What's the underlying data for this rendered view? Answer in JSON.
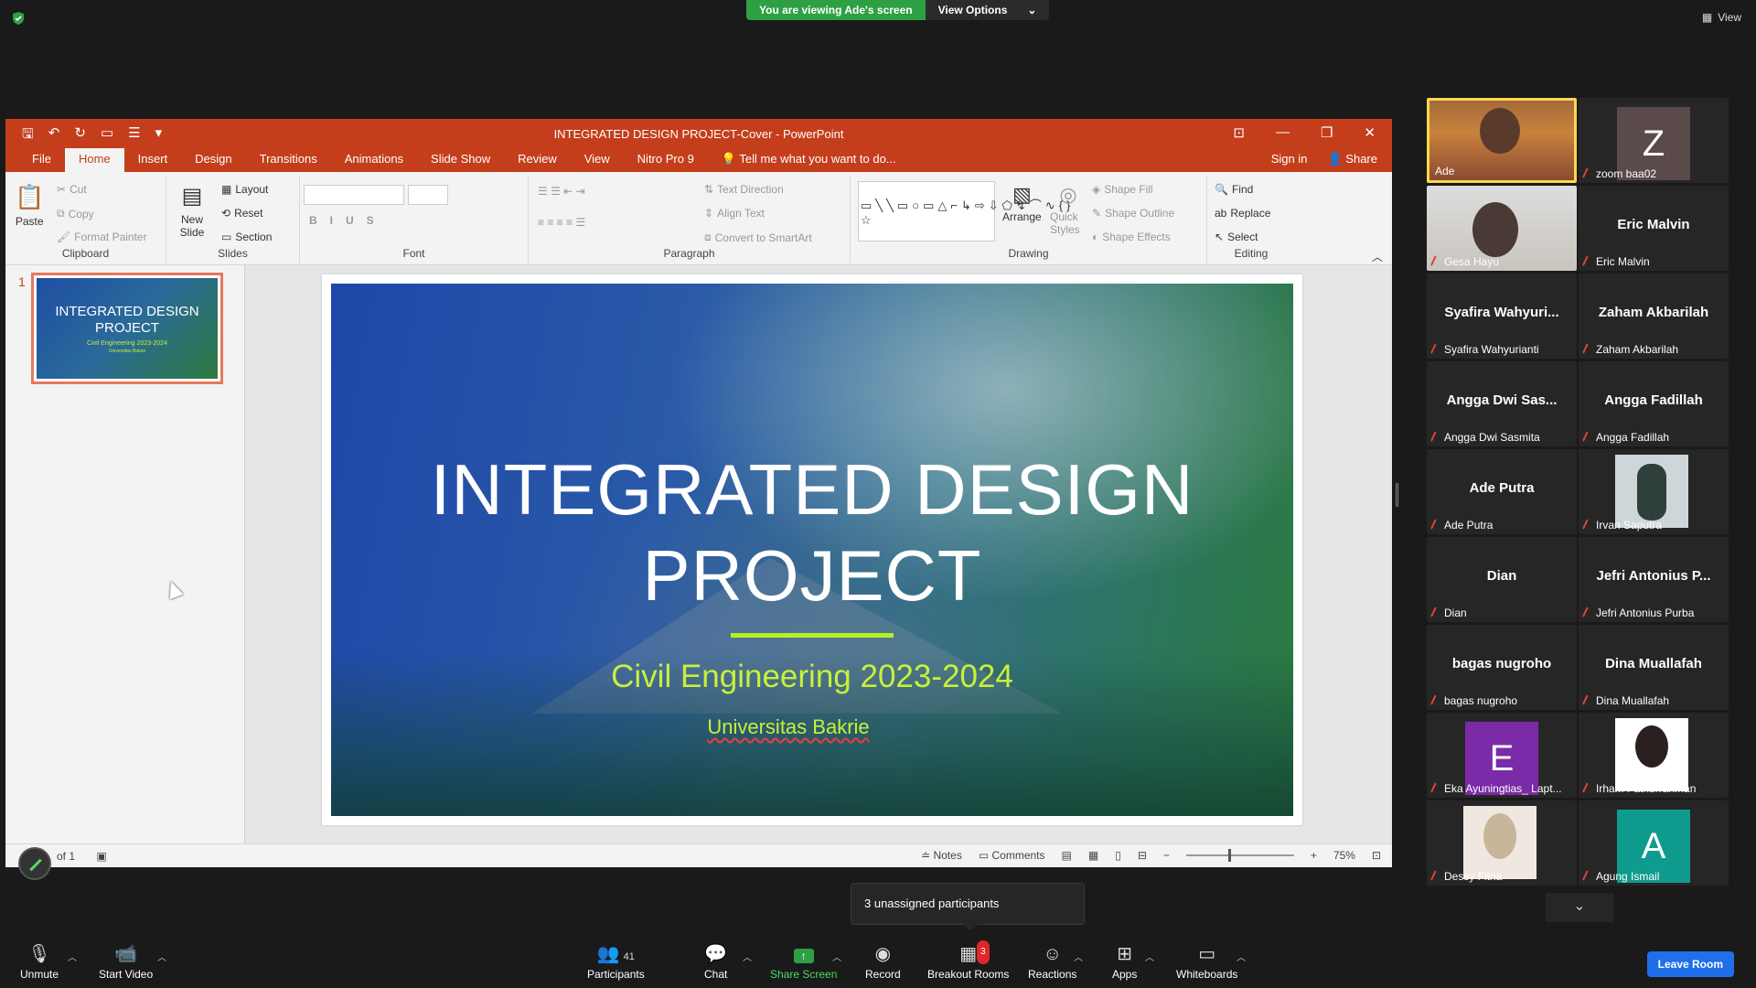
{
  "zoom": {
    "banner_viewing": "You are viewing Ade's screen",
    "banner_view_options": "View Options",
    "top_right_view": "View",
    "unassigned_toast": "3 unassigned participants"
  },
  "ppt": {
    "window_title": "INTEGRATED DESIGN PROJECT-Cover - PowerPoint",
    "tabs": [
      "File",
      "Home",
      "Insert",
      "Design",
      "Transitions",
      "Animations",
      "Slide Show",
      "Review",
      "View",
      "Nitro Pro 9"
    ],
    "tell_me": "Tell me what you want to do...",
    "sign_in": "Sign in",
    "share": "Share",
    "ribbon": {
      "paste": "Paste",
      "cut": "Cut",
      "copy": "Copy",
      "format_painter": "Format Painter",
      "clipboard": "Clipboard",
      "new_slide": "New Slide",
      "layout": "Layout",
      "reset": "Reset",
      "section": "Section",
      "slides": "Slides",
      "font": "Font",
      "text_direction": "Text Direction",
      "align_text": "Align Text",
      "convert_smartart": "Convert to SmartArt",
      "paragraph": "Paragraph",
      "arrange": "Arrange",
      "quick_styles": "Quick Styles",
      "shape_fill": "Shape Fill",
      "shape_outline": "Shape Outline",
      "shape_effects": "Shape Effects",
      "drawing": "Drawing",
      "find": "Find",
      "replace": "Replace",
      "select": "Select",
      "editing": "Editing"
    },
    "thumb_number": "1",
    "thumb_title": "INTEGRATED DESIGN PROJECT",
    "thumb_sub": "Civil Engineering 2023-2024",
    "thumb_sub2": "Universitas Bakrie",
    "slide": {
      "title_line1": "INTEGRATED DESIGN",
      "title_line2": "PROJECT",
      "subtitle": "Civil Engineering 2023-2024",
      "subtitle2": "Universitas Bakrie"
    },
    "status": {
      "slide_of": "of 1",
      "notes": "Notes",
      "comments": "Comments",
      "zoom": "75%"
    }
  },
  "participants": [
    {
      "name": "Ade"
    },
    {
      "name": "zoom baa02",
      "initial": "Z"
    },
    {
      "name": "Gesa Hayu"
    },
    {
      "name": "Eric Malvin",
      "big": "Eric Malvin"
    },
    {
      "name": "Syafira Wahyurianti",
      "big": "Syafira Wahyuri..."
    },
    {
      "name": "Zaham Akbarilah",
      "big": "Zaham Akbarilah"
    },
    {
      "name": "Angga Dwi Sasmita",
      "big": "Angga Dwi Sas..."
    },
    {
      "name": "Angga Fadillah",
      "big": "Angga Fadillah"
    },
    {
      "name": "Ade Putra",
      "big": "Ade Putra"
    },
    {
      "name": "Irvan Saputra"
    },
    {
      "name": "Dian",
      "big": "Dian"
    },
    {
      "name": "Jefri Antonius Purba",
      "big": "Jefri Antonius P..."
    },
    {
      "name": "bagas nugroho",
      "big": "bagas nugroho"
    },
    {
      "name": "Dina Muallafah",
      "big": "Dina Muallafah"
    },
    {
      "name": "Eka Ayuningtias_ Lapt...",
      "initial": "E"
    },
    {
      "name": "Irham Fathurrahman"
    },
    {
      "name": "Dessy Fitria"
    },
    {
      "name": "Agung Ismail",
      "initial": "A"
    }
  ],
  "toolbar": {
    "unmute": "Unmute",
    "start_video": "Start Video",
    "participants": "Participants",
    "participants_count": "41",
    "chat": "Chat",
    "share_screen": "Share Screen",
    "record": "Record",
    "breakout_rooms": "Breakout Rooms",
    "breakout_badge": "3",
    "reactions": "Reactions",
    "apps": "Apps",
    "whiteboards": "Whiteboards",
    "leave_room": "Leave Room"
  },
  "colors": {
    "ppt_accent": "#c43e1c",
    "zoom_green": "#2ea043",
    "slide_accent": "#c8f03a",
    "leave_blue": "#1f6feb"
  }
}
